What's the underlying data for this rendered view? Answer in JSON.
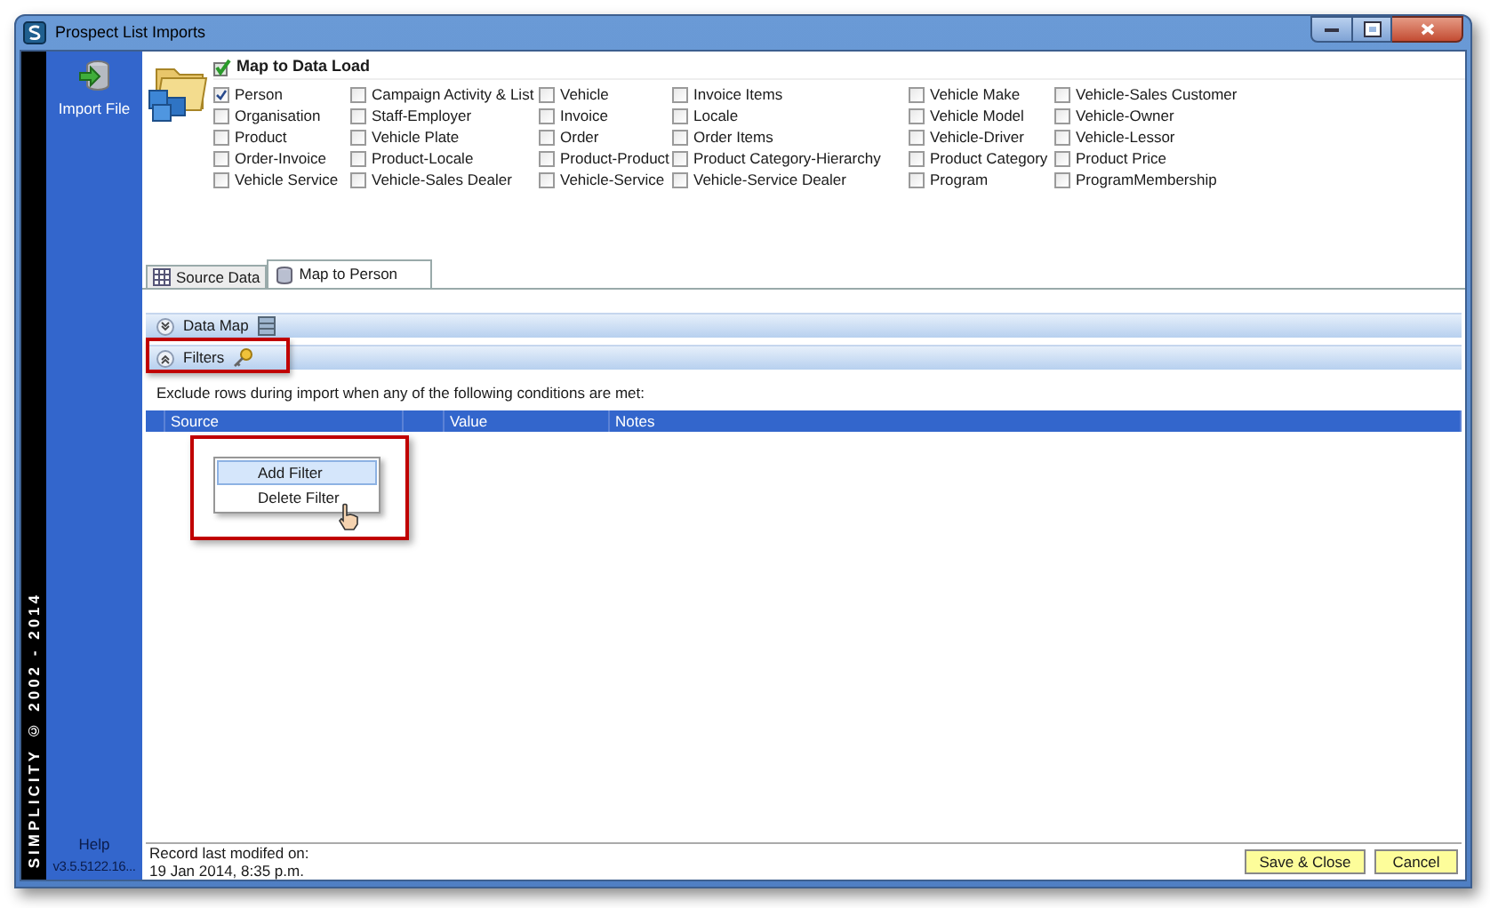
{
  "window": {
    "title": "Prospect List Imports"
  },
  "sidebar": {
    "import_label": "Import File",
    "copyright": "SIMPLICITY © 2002 - 2014",
    "help": "Help",
    "version": "v3.5.5122.16..."
  },
  "data_load": {
    "title": "Map to Data Load",
    "columns": [
      {
        "items": [
          {
            "label": "Person",
            "checked": true
          },
          {
            "label": "Organisation",
            "checked": false
          },
          {
            "label": "Product",
            "checked": false
          },
          {
            "label": "Order-Invoice",
            "checked": false
          },
          {
            "label": "Vehicle Service",
            "checked": false
          }
        ]
      },
      {
        "items": [
          {
            "label": "Campaign Activity & List",
            "checked": false
          },
          {
            "label": "Staff-Employer",
            "checked": false
          },
          {
            "label": "Vehicle Plate",
            "checked": false
          },
          {
            "label": "Product-Locale",
            "checked": false
          },
          {
            "label": "Vehicle-Sales Dealer",
            "checked": false
          }
        ]
      },
      {
        "items": [
          {
            "label": "Vehicle",
            "checked": false
          },
          {
            "label": "Invoice",
            "checked": false
          },
          {
            "label": "Order",
            "checked": false
          },
          {
            "label": "Product-Product",
            "checked": false
          },
          {
            "label": "Vehicle-Service",
            "checked": false
          }
        ]
      },
      {
        "items": [
          {
            "label": "Invoice Items",
            "checked": false
          },
          {
            "label": "Locale",
            "checked": false
          },
          {
            "label": "Order Items",
            "checked": false
          },
          {
            "label": "Product Category-Hierarchy",
            "checked": false
          },
          {
            "label": "Vehicle-Service Dealer",
            "checked": false
          }
        ]
      },
      {
        "items": [
          {
            "label": "Vehicle Make",
            "checked": false
          },
          {
            "label": "Vehicle Model",
            "checked": false
          },
          {
            "label": "Vehicle-Driver",
            "checked": false
          },
          {
            "label": "Product Category",
            "checked": false
          },
          {
            "label": "Program",
            "checked": false
          }
        ]
      },
      {
        "items": [
          {
            "label": "Vehicle-Sales Customer",
            "checked": false
          },
          {
            "label": "Vehicle-Owner",
            "checked": false
          },
          {
            "label": "Vehicle-Lessor",
            "checked": false
          },
          {
            "label": "Product Price",
            "checked": false
          },
          {
            "label": "ProgramMembership",
            "checked": false
          }
        ]
      }
    ]
  },
  "tabs": [
    {
      "label": "Source Data",
      "selected": false
    },
    {
      "label": "Map to Person",
      "selected": true
    }
  ],
  "panels": [
    {
      "title": "Data Map",
      "expanded": false,
      "highlighted": false
    },
    {
      "title": "Filters",
      "expanded": true,
      "highlighted": true
    }
  ],
  "filter_hint": "Exclude rows during import when any of the following conditions are met:",
  "table": {
    "columns": [
      {
        "label": "Source"
      },
      {
        "label": "Value"
      },
      {
        "label": "Notes"
      }
    ]
  },
  "context_menu": {
    "items": [
      {
        "label": "Add Filter",
        "selected": true
      },
      {
        "label": "Delete Filter",
        "selected": false
      }
    ]
  },
  "status": {
    "label": "Record last modifed on:",
    "date": "19 Jan 2014, 8:35 p.m."
  },
  "buttons": [
    {
      "label": "Save & Close"
    },
    {
      "label": "Cancel"
    }
  ]
}
